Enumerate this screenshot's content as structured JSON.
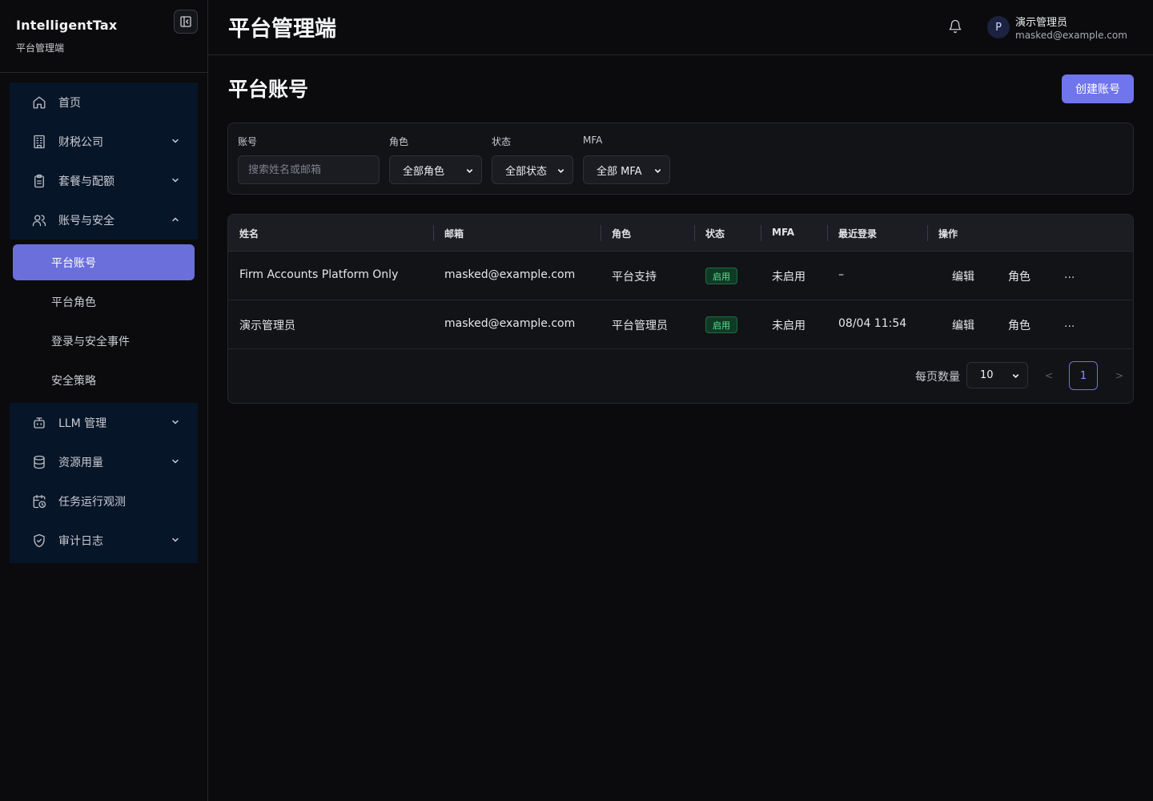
{
  "sidebar": {
    "brand_name": "IntelligentTax",
    "brand_sub": "平台管理端",
    "items": [
      {
        "label": "首页",
        "icon": "home-icon"
      },
      {
        "label": "财税公司",
        "icon": "building-icon"
      },
      {
        "label": "套餐与配额",
        "icon": "clipboard-icon"
      },
      {
        "label": "账号与安全",
        "icon": "users-icon"
      },
      {
        "label": "LLM 管理",
        "icon": "bot-icon"
      },
      {
        "label": "资源用量",
        "icon": "database-icon"
      },
      {
        "label": "任务运行观测",
        "icon": "calendar-clock-icon"
      },
      {
        "label": "审计日志",
        "icon": "shield-check-icon"
      }
    ],
    "sub_items": [
      "平台账号",
      "平台角色",
      "登录与安全事件",
      "安全策略"
    ]
  },
  "header": {
    "title": "平台管理端",
    "avatar_letter": "P",
    "user_name": "演示管理员",
    "user_email": "masked@example.com"
  },
  "page": {
    "title": "平台账号",
    "create_label": "创建账号"
  },
  "filters": {
    "account_label": "账号",
    "account_placeholder": "搜索姓名或邮箱",
    "role_label": "角色",
    "role_value": "全部角色",
    "status_label": "状态",
    "status_value": "全部状态",
    "mfa_label": "MFA",
    "mfa_value": "全部 MFA"
  },
  "table": {
    "columns": [
      "姓名",
      "邮箱",
      "角色",
      "状态",
      "MFA",
      "最近登录",
      "操作"
    ],
    "rows": [
      {
        "name": "Firm Accounts Platform Only",
        "email": "masked@example.com",
        "role": "平台支持",
        "status": "启用",
        "mfa": "未启用",
        "last_login": "–",
        "actions": [
          "编辑",
          "角色",
          "..."
        ]
      },
      {
        "name": "演示管理员",
        "email": "masked@example.com",
        "role": "平台管理员",
        "status": "启用",
        "mfa": "未启用",
        "last_login": "08/04 11:54",
        "actions": [
          "编辑",
          "角色",
          "..."
        ]
      }
    ]
  },
  "pagination": {
    "per_page_label": "每页数量",
    "per_page_value": "10",
    "prev": "<",
    "next": ">",
    "current_page": "1"
  },
  "colors": {
    "accent": "#7075ee",
    "active_nav": "#6b6fdc",
    "nav_group_bg": "#071528",
    "badge_green": "#5ee095"
  }
}
